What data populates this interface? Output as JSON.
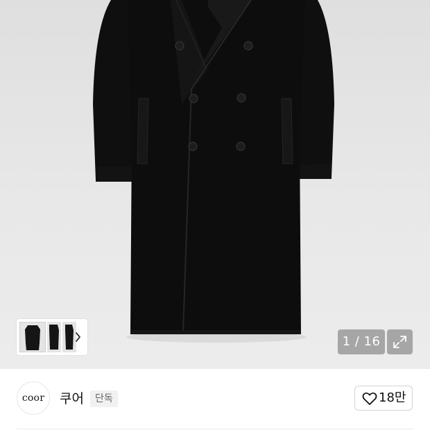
{
  "gallery": {
    "current_page": "1",
    "total_pages": "16",
    "counter_text": "1 / 16"
  },
  "brand": {
    "logo_text": "coor",
    "name": "쿠어",
    "badge": "단독"
  },
  "likes": {
    "count": "18만"
  },
  "colors": {
    "background_gray": "#e6e6e6",
    "coat_black": "#0e0e0e",
    "overlay_gray": "#8a8a8a"
  },
  "icons": {
    "thumbs_next": "chevron-right-icon",
    "expand": "expand-arrows-icon",
    "like": "heart-outline-icon"
  }
}
